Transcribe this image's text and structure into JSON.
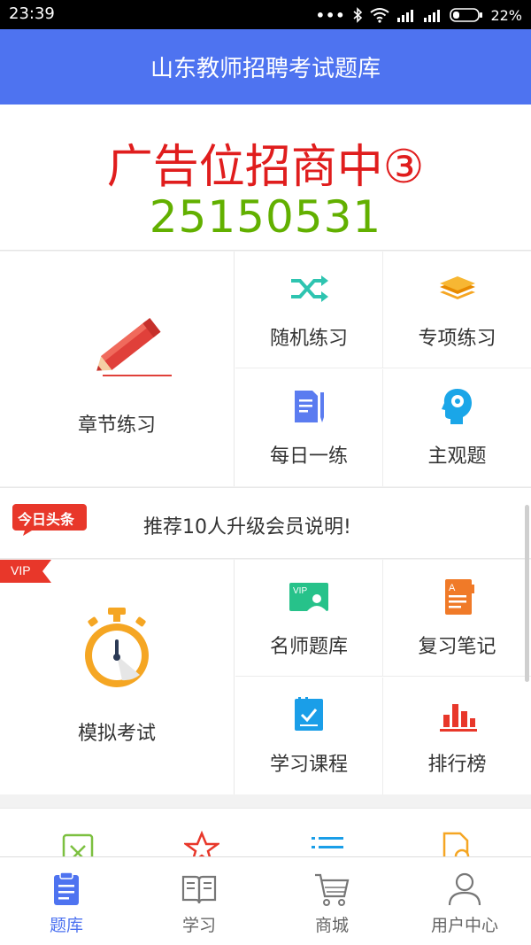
{
  "status": {
    "time": "23:39",
    "battery": "22%"
  },
  "app": {
    "title": "山东教师招聘考试题库"
  },
  "banner": {
    "ad_text": "广告位招商中③",
    "phone": "25150531"
  },
  "practice": {
    "chapter": "章节练习",
    "random": "随机练习",
    "special": "专项练习",
    "daily": "每日一练",
    "subjective": "主观题"
  },
  "news": {
    "tag": "今日头条",
    "text": "推荐10人升级会员说明!"
  },
  "exam": {
    "vip": "VIP",
    "mock": "模拟考试",
    "teacher_bank": "名师题库",
    "notes": "复习笔记",
    "course": "学习课程",
    "ranking": "排行榜"
  },
  "tabs": [
    {
      "label": "题库",
      "icon": "question-bank-icon",
      "active": true
    },
    {
      "label": "学习",
      "icon": "book-icon",
      "active": false
    },
    {
      "label": "商城",
      "icon": "cart-icon",
      "active": false
    },
    {
      "label": "用户中心",
      "icon": "user-icon",
      "active": false
    }
  ],
  "colors": {
    "primary": "#4e73f0",
    "ad_red": "#e01d1d",
    "phone_green": "#62b000"
  }
}
